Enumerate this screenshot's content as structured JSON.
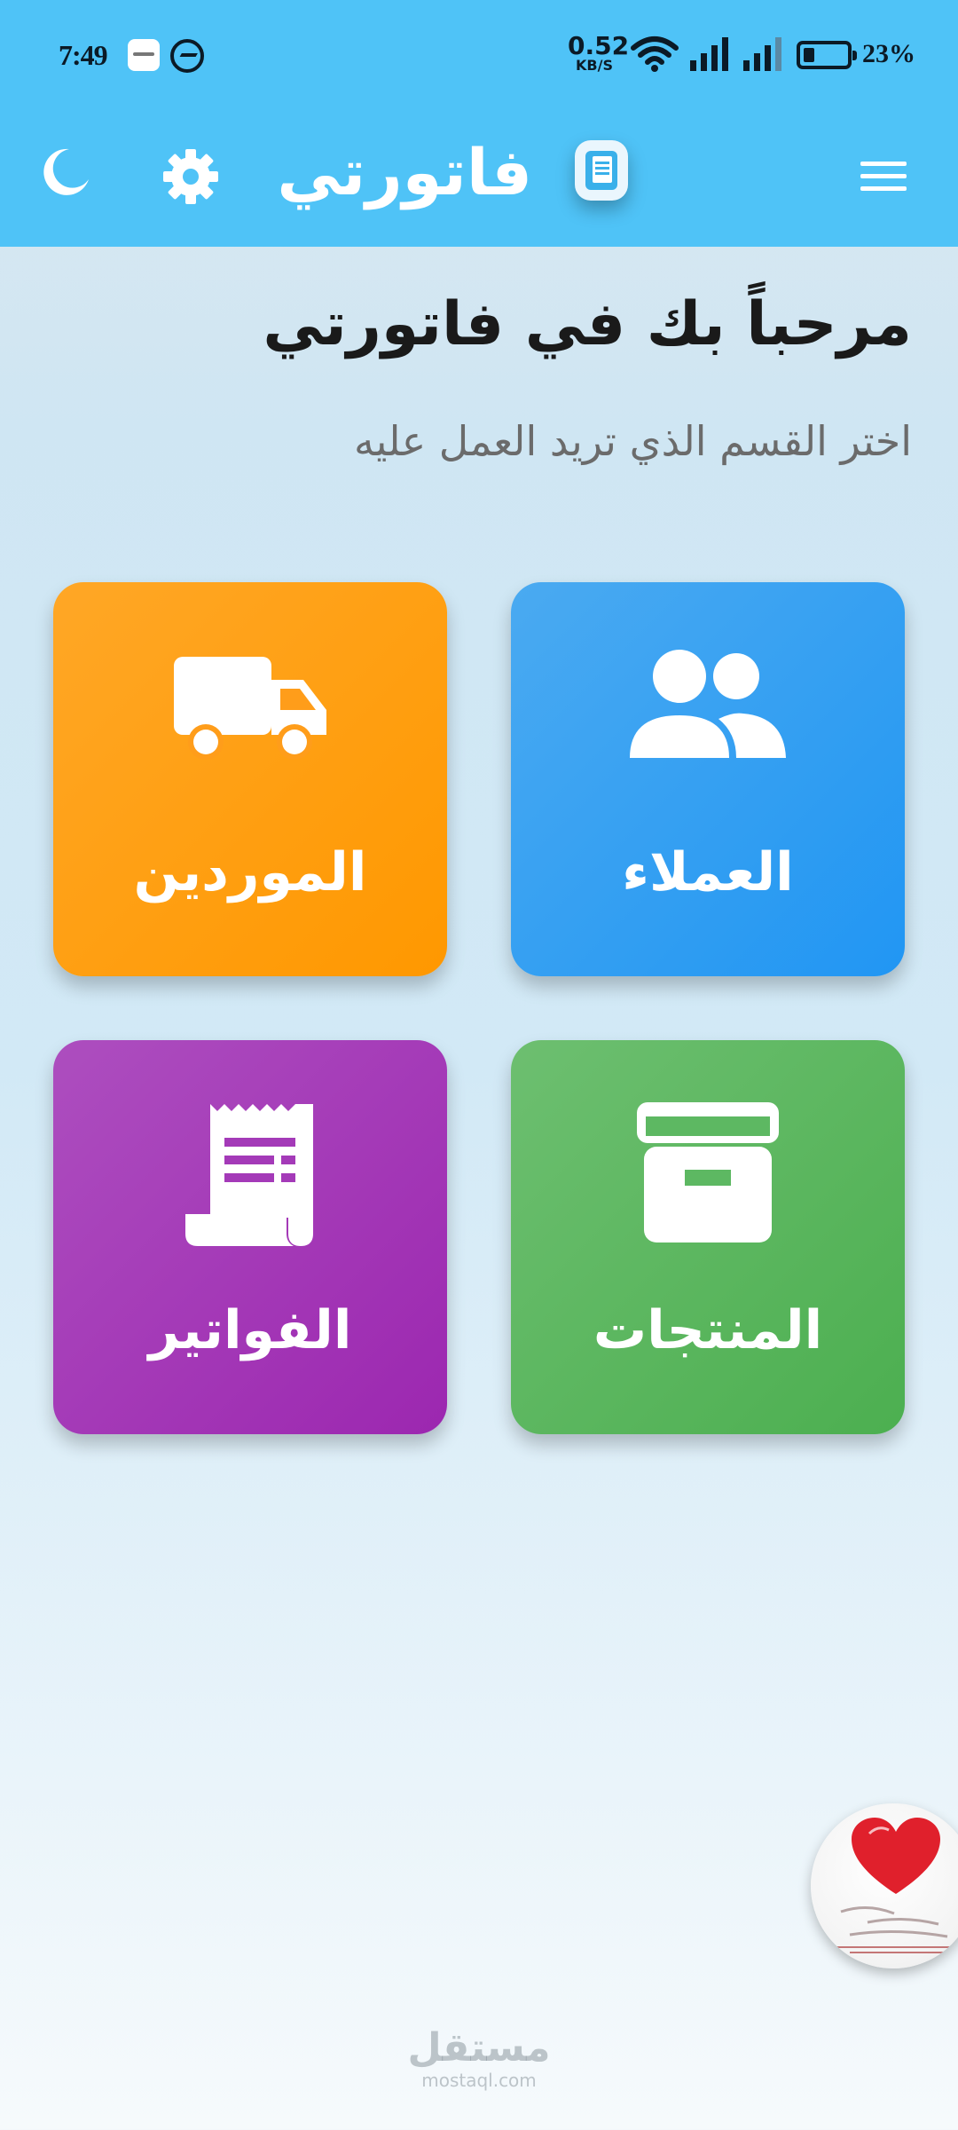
{
  "status_bar": {
    "time": "7:49",
    "net_speed_value": "0.52",
    "net_speed_unit": "KB/S",
    "battery_percent": "23%",
    "icons": [
      "notification-app-icon",
      "messenger-icon",
      "wifi-icon",
      "signal-icon",
      "signal-icon",
      "battery-icon"
    ]
  },
  "app_bar": {
    "title": "فاتورتي",
    "icons": [
      "moon-icon",
      "gear-icon",
      "app-logo-icon",
      "menu-icon"
    ]
  },
  "welcome": {
    "title": "مرحباً بك في فاتورتي",
    "subtitle": "اختر القسم الذي تريد العمل عليه"
  },
  "tiles": [
    {
      "label": "العملاء",
      "icon": "people-icon",
      "color": "#2196f3"
    },
    {
      "label": "الموردين",
      "icon": "truck-icon",
      "color": "#ff9800"
    },
    {
      "label": "المنتجات",
      "icon": "archive-box-icon",
      "color": "#4caf50"
    },
    {
      "label": "الفواتير",
      "icon": "receipt-icon",
      "color": "#9c27b0"
    }
  ],
  "watermark": {
    "arabic": "مستقل",
    "latin": "mostaql.com"
  },
  "colors": {
    "app_bar": "#4fc3f7",
    "title_text": "#1a1a1a",
    "subtitle_text": "#6b6b6b"
  }
}
